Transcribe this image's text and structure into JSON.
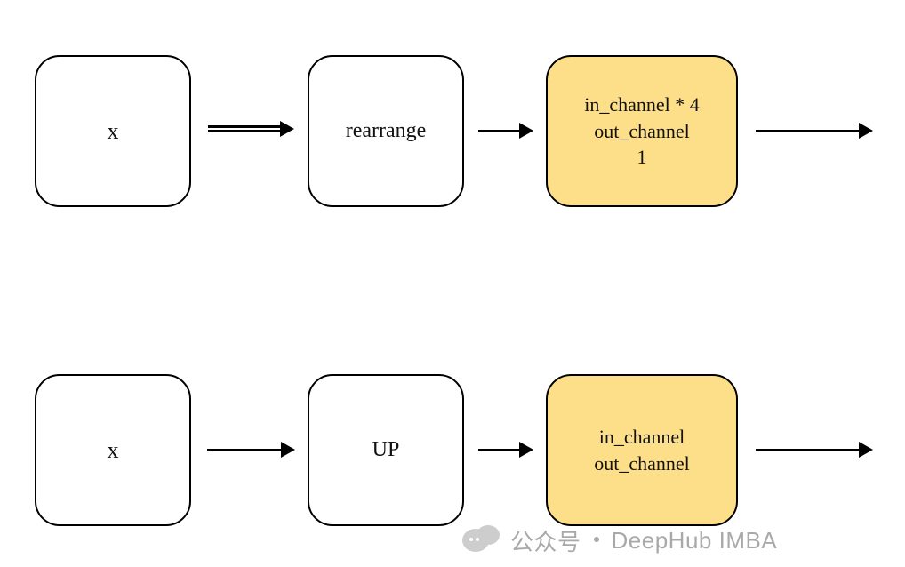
{
  "row1": {
    "input": "x",
    "op": "rearrange",
    "block": {
      "line1": "in_channel * 4",
      "line2": "out_channel",
      "line3": "1"
    }
  },
  "row2": {
    "input": "x",
    "op": "UP",
    "block": {
      "line1": "in_channel",
      "line2": "out_channel"
    }
  },
  "watermark": {
    "label": "公众号",
    "brand": "DeepHub IMBA"
  }
}
